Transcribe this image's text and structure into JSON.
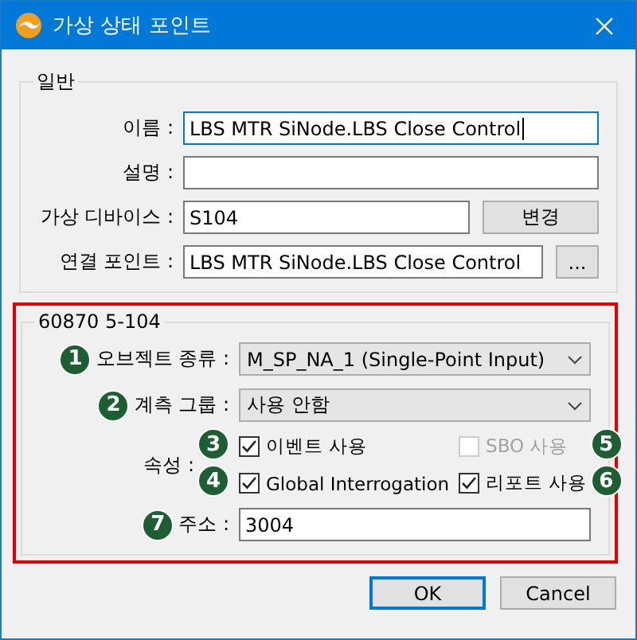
{
  "window": {
    "title": "가상 상태 포인트"
  },
  "general": {
    "title": "일반",
    "fields": [
      {
        "kind": "text",
        "label": "이름 :",
        "value": "LBS MTR SiNode.LBS Close Control",
        "focused": true
      },
      {
        "kind": "text",
        "label": "설명 :",
        "focused": false
      },
      {
        "kind": "button",
        "label": "가상 디바이스 :",
        "value": "S104",
        "button": "변경",
        "focused": false
      },
      {
        "kind": "browse",
        "label": "연결 포인트 :",
        "value": "LBS MTR SiNode.LBS Close Control",
        "button": "...",
        "focused": false
      }
    ]
  },
  "protocol": {
    "title": "60870 5-104",
    "highlighted": true,
    "object_type": {
      "badge": "1",
      "label": "오브젝트 종류 :",
      "value": "M_SP_NA_1 (Single-Point Input)"
    },
    "group": {
      "badge": "2",
      "label": "계측 그룹 :",
      "value": "사용 안함"
    },
    "attributes": {
      "label": "속성 :",
      "options": [
        {
          "badge": "3",
          "label": "이벤트 사용",
          "checked": true,
          "disabled": false
        },
        {
          "badge": "5",
          "label": "SBO 사용",
          "checked": false,
          "disabled": true
        },
        {
          "badge": "4",
          "label": "Global Interrogation",
          "checked": true,
          "disabled": false
        },
        {
          "badge": "6",
          "label": "리포트 사용",
          "checked": true,
          "disabled": false
        }
      ]
    },
    "address": {
      "badge": "7",
      "label": "주소 :",
      "value": "3004"
    }
  },
  "buttons": [
    {
      "label": "OK",
      "default": true
    },
    {
      "label": "Cancel",
      "default": false
    }
  ]
}
